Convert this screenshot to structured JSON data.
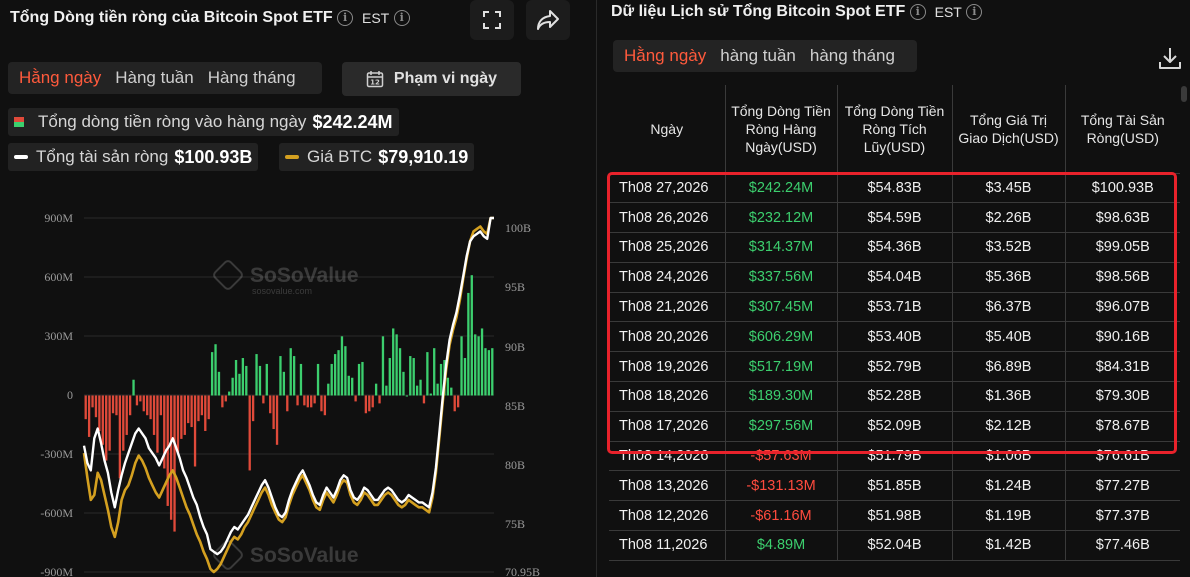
{
  "left": {
    "title": "Tổng Dòng tiền ròng của Bitcoin Spot ETF",
    "timezone": "EST",
    "tabs": [
      "Hằng ngày",
      "Hàng tuần",
      "Hàng tháng"
    ],
    "range_label": "Phạm vi ngày",
    "legend": {
      "daily_flow_label": "Tổng dòng tiền ròng vào hàng ngày",
      "daily_flow_value": "$242.24M",
      "net_assets_label": "Tổng tài sản ròng",
      "net_assets_value": "$100.93B",
      "btc_price_label": "Giá BTC",
      "btc_price_value": "$79,910.19"
    },
    "watermark": {
      "brand": "SoSoValue",
      "domain": "sosovalue.com"
    }
  },
  "chart_data": {
    "type": "bar",
    "left_axis": {
      "ticks": [
        "900M",
        "600M",
        "300M",
        "0",
        "-300M",
        "-600M",
        "-900M"
      ],
      "ylim": [
        -900,
        900
      ],
      "unit": "M"
    },
    "right_axis": {
      "ticks": [
        "100B",
        "95B",
        "90B",
        "85B",
        "80B",
        "75B",
        "70.95B"
      ],
      "ylim": [
        70.95,
        100.5
      ],
      "unit": "B"
    },
    "colors": {
      "positive": "#3ccf6e",
      "negative": "#e04a3a",
      "net_assets": "#ffffff",
      "btc_price": "#d4a020"
    },
    "values": [
      -120,
      -210,
      -60,
      -110,
      -180,
      -250,
      -330,
      -280,
      -90,
      -100,
      -420,
      -280,
      -200,
      -100,
      80,
      -50,
      -30,
      -80,
      -100,
      -120,
      -200,
      -290,
      -100,
      -370,
      -560,
      -630,
      -690,
      -290,
      -220,
      -200,
      -140,
      -160,
      -360,
      -130,
      -100,
      -180,
      -120,
      220,
      260,
      120,
      -60,
      -30,
      20,
      90,
      180,
      110,
      190,
      150,
      -380,
      -130,
      210,
      150,
      -40,
      160,
      -90,
      -170,
      -250,
      200,
      120,
      -80,
      240,
      200,
      -50,
      160,
      -50,
      -60,
      -60,
      -40,
      160,
      -80,
      -100,
      60,
      160,
      210,
      230,
      300,
      250,
      100,
      90,
      -30,
      160,
      170,
      -90,
      -80,
      -60,
      60,
      -40,
      300,
      50,
      190,
      340,
      310,
      240,
      120,
      0,
      200,
      190,
      50,
      80,
      -40,
      220,
      10,
      240,
      60,
      160,
      180,
      90,
      40,
      -80,
      -60,
      300,
      190,
      520,
      610,
      310,
      300,
      340,
      240,
      230,
      240
    ],
    "net_assets": [
      81.2,
      79.8,
      79.2,
      81.8,
      82.6,
      81.4,
      80.0,
      79.0,
      77.4,
      76.2,
      77.6,
      78.8,
      79.8,
      80.6,
      81.4,
      82.2,
      82.6,
      82.2,
      81.8,
      81.0,
      80.6,
      80.2,
      79.6,
      80.2,
      80.8,
      81.2,
      81.8,
      81.0,
      80.2,
      79.2,
      78.6,
      77.8,
      77.0,
      76.4,
      75.4,
      74.6,
      74.0,
      72.8,
      72.6,
      72.4,
      72.6,
      73.0,
      73.6,
      74.2,
      74.6,
      74.4,
      74.8,
      75.2,
      75.6,
      76.2,
      76.8,
      77.4,
      78.0,
      78.4,
      77.8,
      77.0,
      76.2,
      75.6,
      75.4,
      75.8,
      76.8,
      77.6,
      78.2,
      78.8,
      79.2,
      78.6,
      78.0,
      77.2,
      76.6,
      76.4,
      77.2,
      77.8,
      77.4,
      77.0,
      77.6,
      78.4,
      78.8,
      78.6,
      77.6,
      77.0,
      76.8,
      77.2,
      77.8,
      77.6,
      77.2,
      76.8,
      76.8,
      77.2,
      77.6,
      77.8,
      77.6,
      77.2,
      76.8,
      76.6,
      76.8,
      77.2,
      77.0,
      76.8,
      76.6,
      76.6,
      76.4,
      76.2,
      77.4,
      79.4,
      82.2,
      85.2,
      87.8,
      89.8,
      91.0,
      92.0,
      93.4,
      95.0,
      96.6,
      97.8,
      98.2,
      98.4,
      98.6,
      98.2,
      98.0,
      99.8,
      100.93
    ],
    "btc_price": [
      80.6,
      78.6,
      76.8,
      77.2,
      79.0,
      78.4,
      77.2,
      76.0,
      74.6,
      73.8,
      75.0,
      76.8,
      77.6,
      78.0,
      78.8,
      79.8,
      80.4,
      80.0,
      79.4,
      78.6,
      78.0,
      77.4,
      77.0,
      77.6,
      78.2,
      78.8,
      79.2,
      78.6,
      77.8,
      77.0,
      76.2,
      75.6,
      74.8,
      74.0,
      73.4,
      72.6,
      72.0,
      71.2,
      70.95,
      71.2,
      71.6,
      72.2,
      72.8,
      73.4,
      73.8,
      73.6,
      74.0,
      74.6,
      75.0,
      75.6,
      76.2,
      76.8,
      77.4,
      77.8,
      77.2,
      76.4,
      75.8,
      75.2,
      75.0,
      75.4,
      76.4,
      77.2,
      77.8,
      78.4,
      78.8,
      78.2,
      77.6,
      76.8,
      76.2,
      76.0,
      76.8,
      77.4,
      77.0,
      76.6,
      77.2,
      78.0,
      78.4,
      78.2,
      77.2,
      76.6,
      76.4,
      76.8,
      77.4,
      77.2,
      76.8,
      76.4,
      76.4,
      76.8,
      77.2,
      77.4,
      77.2,
      76.8,
      76.4,
      76.2,
      76.4,
      76.8,
      76.6,
      76.4,
      76.2,
      76.2,
      76.0,
      75.8,
      77.0,
      79.0,
      81.8,
      84.8,
      87.4,
      89.4,
      90.6,
      91.6,
      93.0,
      94.8,
      96.4,
      97.8,
      98.6,
      98.8,
      99.0,
      98.6,
      98.4,
      100.2,
      101.2
    ]
  },
  "right": {
    "title": "Dữ liệu Lịch sử Tổng Bitcoin Spot ETF",
    "timezone": "EST",
    "tabs": [
      "Hằng ngày",
      "hàng tuần",
      "hàng tháng"
    ],
    "columns": [
      "Ngày",
      "Tổng Dòng Tiền Ròng Hàng Ngày(USD)",
      "Tổng Dòng Tiền Ròng Tích Lũy(USD)",
      "Tổng Giá Trị Giao Dịch(USD)",
      "Tổng Tài Sản Ròng(USD)"
    ],
    "rows": [
      {
        "date": "Th08 27,2026",
        "daily": "$242.24M",
        "sign": "pos",
        "cumulative": "$54.83B",
        "traded": "$3.45B",
        "assets": "$100.93B"
      },
      {
        "date": "Th08 26,2026",
        "daily": "$232.12M",
        "sign": "pos",
        "cumulative": "$54.59B",
        "traded": "$2.26B",
        "assets": "$98.63B"
      },
      {
        "date": "Th08 25,2026",
        "daily": "$314.37M",
        "sign": "pos",
        "cumulative": "$54.36B",
        "traded": "$3.52B",
        "assets": "$99.05B"
      },
      {
        "date": "Th08 24,2026",
        "daily": "$337.56M",
        "sign": "pos",
        "cumulative": "$54.04B",
        "traded": "$5.36B",
        "assets": "$98.56B"
      },
      {
        "date": "Th08 21,2026",
        "daily": "$307.45M",
        "sign": "pos",
        "cumulative": "$53.71B",
        "traded": "$6.37B",
        "assets": "$96.07B"
      },
      {
        "date": "Th08 20,2026",
        "daily": "$606.29M",
        "sign": "pos",
        "cumulative": "$53.40B",
        "traded": "$5.40B",
        "assets": "$90.16B"
      },
      {
        "date": "Th08 19,2026",
        "daily": "$517.19M",
        "sign": "pos",
        "cumulative": "$52.79B",
        "traded": "$6.89B",
        "assets": "$84.31B"
      },
      {
        "date": "Th08 18,2026",
        "daily": "$189.30M",
        "sign": "pos",
        "cumulative": "$52.28B",
        "traded": "$1.36B",
        "assets": "$79.30B"
      },
      {
        "date": "Th08 17,2026",
        "daily": "$297.56M",
        "sign": "pos",
        "cumulative": "$52.09B",
        "traded": "$2.12B",
        "assets": "$78.67B"
      },
      {
        "date": "Th08 14,2026",
        "daily": "-$57.63M",
        "sign": "neg",
        "cumulative": "$51.79B",
        "traded": "$1.06B",
        "assets": "$76.61B"
      },
      {
        "date": "Th08 13,2026",
        "daily": "-$131.13M",
        "sign": "neg",
        "cumulative": "$51.85B",
        "traded": "$1.24B",
        "assets": "$77.27B"
      },
      {
        "date": "Th08 12,2026",
        "daily": "-$61.16M",
        "sign": "neg",
        "cumulative": "$51.98B",
        "traded": "$1.19B",
        "assets": "$77.37B"
      },
      {
        "date": "Th08 11,2026",
        "daily": "$4.89M",
        "sign": "pos",
        "cumulative": "$52.04B",
        "traded": "$1.42B",
        "assets": "$77.46B"
      }
    ]
  }
}
